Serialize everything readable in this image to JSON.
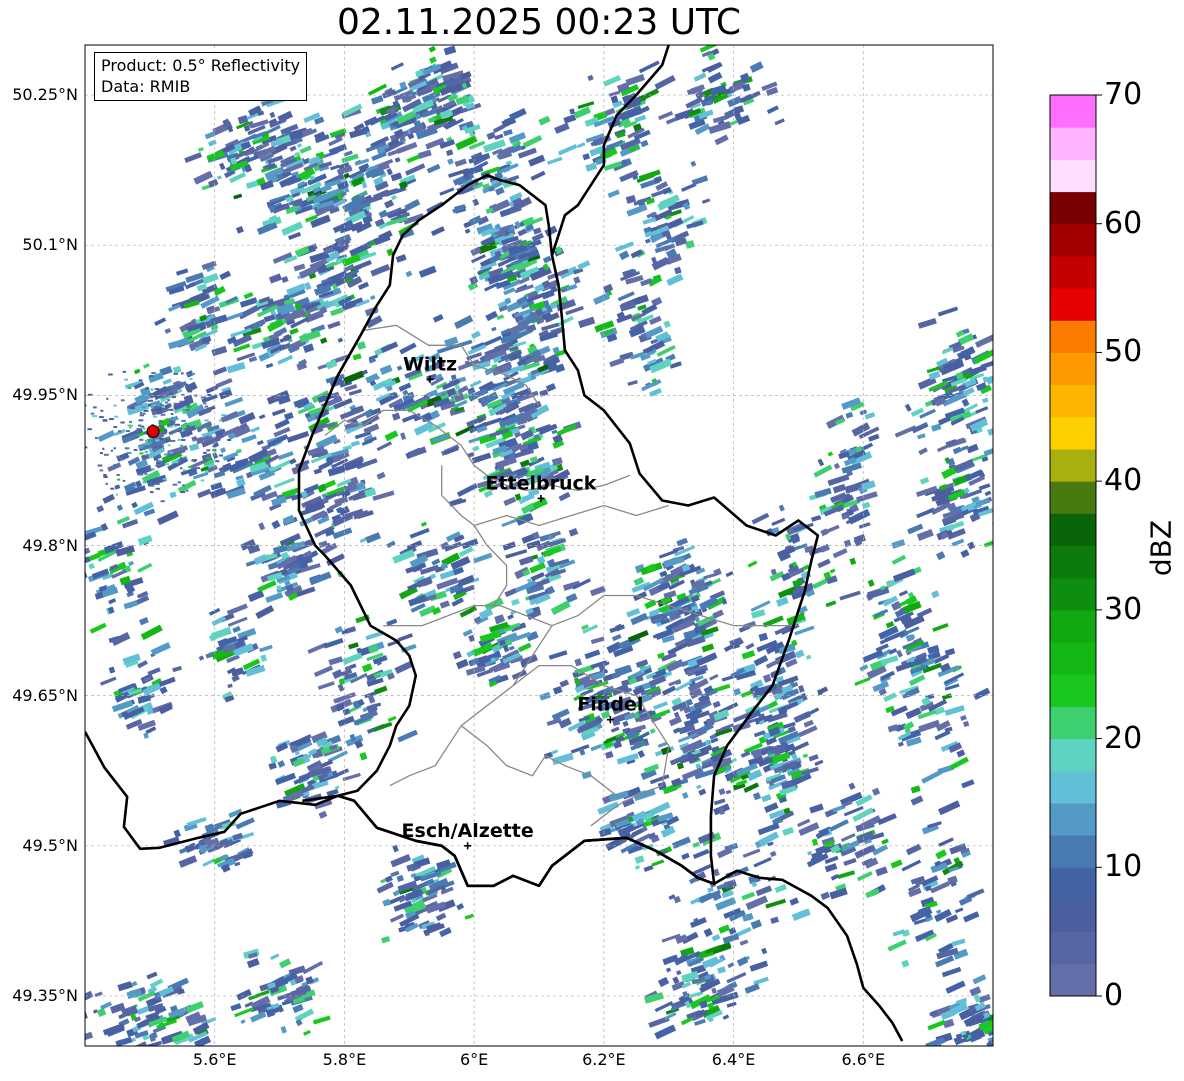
{
  "title": "02.11.2025 00:23 UTC",
  "info": {
    "product": "Product: 0.5° Reflectivity",
    "data": "Data: RMIB"
  },
  "map": {
    "lat_range": [
      49.3,
      50.3
    ],
    "lon_range": [
      5.4,
      6.8
    ],
    "lat_ticks": [
      {
        "value": 50.25,
        "label": "50.25°N"
      },
      {
        "value": 50.1,
        "label": "50.1°N"
      },
      {
        "value": 49.95,
        "label": "49.95°N"
      },
      {
        "value": 49.8,
        "label": "49.8°N"
      },
      {
        "value": 49.65,
        "label": "49.65°N"
      },
      {
        "value": 49.5,
        "label": "49.5°N"
      },
      {
        "value": 49.35,
        "label": "49.35°N"
      }
    ],
    "lon_ticks": [
      {
        "value": 5.6,
        "label": "5.6°E"
      },
      {
        "value": 5.8,
        "label": "5.8°E"
      },
      {
        "value": 6.0,
        "label": "6°E"
      },
      {
        "value": 6.2,
        "label": "6.2°E"
      },
      {
        "value": 6.4,
        "label": "6.4°E"
      },
      {
        "value": 6.6,
        "label": "6.6°E"
      }
    ],
    "grid": true,
    "radar_site": {
      "lon": 5.505,
      "lat": 49.914,
      "color": "#e00000"
    },
    "cities": [
      {
        "name": "Wiltz",
        "lon": 5.932,
        "lat": 49.966
      },
      {
        "name": "Ettelbruck",
        "lon": 6.103,
        "lat": 49.847
      },
      {
        "name": "Findel",
        "lon": 6.21,
        "lat": 49.626
      },
      {
        "name": "Esch/Alzette",
        "lon": 5.99,
        "lat": 49.5
      }
    ],
    "country_border": [
      [
        5.4,
        49.614
      ],
      [
        5.43,
        49.578
      ],
      [
        5.465,
        49.549
      ],
      [
        5.46,
        49.519
      ],
      [
        5.485,
        49.497
      ],
      [
        5.515,
        49.498
      ],
      [
        5.575,
        49.508
      ],
      [
        5.615,
        49.514
      ],
      [
        5.64,
        49.532
      ],
      [
        5.7,
        49.545
      ],
      [
        5.755,
        49.541
      ],
      [
        5.79,
        49.55
      ],
      [
        5.815,
        49.545
      ],
      [
        5.85,
        49.518
      ],
      [
        5.91,
        49.505
      ],
      [
        5.95,
        49.5
      ],
      [
        5.97,
        49.49
      ],
      [
        5.99,
        49.46
      ],
      [
        6.03,
        49.46
      ],
      [
        6.06,
        49.47
      ],
      [
        6.1,
        49.46
      ],
      [
        6.12,
        49.48
      ],
      [
        6.17,
        49.505
      ],
      [
        6.235,
        49.508
      ],
      [
        6.28,
        49.495
      ],
      [
        6.32,
        49.48
      ],
      [
        6.345,
        49.468
      ],
      [
        6.37,
        49.462
      ],
      [
        6.405,
        49.475
      ],
      [
        6.44,
        49.468
      ],
      [
        6.475,
        49.466
      ],
      [
        6.52,
        49.45
      ],
      [
        6.545,
        49.438
      ],
      [
        6.575,
        49.41
      ],
      [
        6.59,
        49.382
      ],
      [
        6.6,
        49.358
      ],
      [
        6.625,
        49.34
      ],
      [
        6.645,
        49.323
      ],
      [
        6.66,
        49.305
      ]
    ],
    "luxembourg_border": [
      [
        5.735,
        49.545
      ],
      [
        5.79,
        49.55
      ],
      [
        5.815,
        49.545
      ],
      [
        5.85,
        49.518
      ],
      [
        5.91,
        49.505
      ],
      [
        5.95,
        49.5
      ],
      [
        5.97,
        49.49
      ],
      [
        5.99,
        49.46
      ],
      [
        6.03,
        49.46
      ],
      [
        6.06,
        49.47
      ],
      [
        6.1,
        49.46
      ],
      [
        6.12,
        49.48
      ],
      [
        6.17,
        49.505
      ],
      [
        6.235,
        49.508
      ],
      [
        6.28,
        49.495
      ],
      [
        6.32,
        49.48
      ],
      [
        6.345,
        49.468
      ],
      [
        6.37,
        49.462
      ],
      [
        6.365,
        49.49
      ],
      [
        6.365,
        49.53
      ],
      [
        6.37,
        49.57
      ],
      [
        6.39,
        49.6
      ],
      [
        6.43,
        49.635
      ],
      [
        6.46,
        49.66
      ],
      [
        6.485,
        49.705
      ],
      [
        6.51,
        49.755
      ],
      [
        6.52,
        49.785
      ],
      [
        6.53,
        49.81
      ],
      [
        6.5,
        49.825
      ],
      [
        6.465,
        49.81
      ],
      [
        6.42,
        49.82
      ],
      [
        6.37,
        49.848
      ],
      [
        6.33,
        49.84
      ],
      [
        6.29,
        49.845
      ],
      [
        6.255,
        49.872
      ],
      [
        6.24,
        49.902
      ],
      [
        6.2,
        49.935
      ],
      [
        6.17,
        49.95
      ],
      [
        6.16,
        49.975
      ],
      [
        6.14,
        49.995
      ],
      [
        6.135,
        50.03
      ],
      [
        6.13,
        50.06
      ],
      [
        6.12,
        50.09
      ],
      [
        6.115,
        50.12
      ],
      [
        6.11,
        50.14
      ],
      [
        6.09,
        50.15
      ],
      [
        6.07,
        50.16
      ],
      [
        6.04,
        50.165
      ],
      [
        6.02,
        50.17
      ],
      [
        5.99,
        50.16
      ],
      [
        5.97,
        50.15
      ],
      [
        5.95,
        50.14
      ],
      [
        5.915,
        50.125
      ],
      [
        5.89,
        50.11
      ],
      [
        5.875,
        50.09
      ],
      [
        5.87,
        50.06
      ],
      [
        5.85,
        50.04
      ],
      [
        5.825,
        50.01
      ],
      [
        5.79,
        49.97
      ],
      [
        5.77,
        49.94
      ],
      [
        5.75,
        49.91
      ],
      [
        5.73,
        49.875
      ],
      [
        5.73,
        49.835
      ],
      [
        5.755,
        49.8
      ],
      [
        5.77,
        49.79
      ],
      [
        5.81,
        49.76
      ],
      [
        5.84,
        49.72
      ],
      [
        5.88,
        49.705
      ],
      [
        5.9,
        49.69
      ],
      [
        5.91,
        49.67
      ],
      [
        5.9,
        49.64
      ],
      [
        5.88,
        49.62
      ],
      [
        5.87,
        49.6
      ],
      [
        5.85,
        49.575
      ],
      [
        5.82,
        49.555
      ],
      [
        5.79,
        49.55
      ]
    ],
    "germany_border_north": [
      [
        6.12,
        50.09
      ],
      [
        6.13,
        50.11
      ],
      [
        6.14,
        50.13
      ],
      [
        6.16,
        50.14
      ],
      [
        6.18,
        50.16
      ],
      [
        6.2,
        50.18
      ],
      [
        6.2,
        50.2
      ],
      [
        6.22,
        50.23
      ],
      [
        6.25,
        50.25
      ],
      [
        6.27,
        50.265
      ],
      [
        6.29,
        50.28
      ],
      [
        6.3,
        50.3
      ]
    ],
    "cantonal_lines": [
      [
        [
          5.83,
          50.015
        ],
        [
          5.88,
          50.02
        ],
        [
          5.93,
          50.0
        ],
        [
          5.98,
          50.0
        ],
        [
          6.0,
          49.98
        ],
        [
          6.05,
          49.97
        ],
        [
          6.08,
          49.96
        ],
        [
          6.1,
          49.94
        ]
      ],
      [
        [
          5.77,
          49.91
        ],
        [
          5.8,
          49.925
        ],
        [
          5.83,
          49.92
        ],
        [
          5.86,
          49.935
        ],
        [
          5.9,
          49.935
        ],
        [
          5.94,
          49.92
        ],
        [
          5.98,
          49.9
        ],
        [
          6.0,
          49.88
        ],
        [
          6.02,
          49.87
        ],
        [
          6.05,
          49.86
        ],
        [
          6.08,
          49.855
        ],
        [
          6.12,
          49.86
        ],
        [
          6.16,
          49.855
        ],
        [
          6.2,
          49.86
        ],
        [
          6.24,
          49.87
        ]
      ],
      [
        [
          5.95,
          49.88
        ],
        [
          5.95,
          49.85
        ],
        [
          5.98,
          49.83
        ],
        [
          6.0,
          49.82
        ],
        [
          6.02,
          49.8
        ],
        [
          6.05,
          49.78
        ],
        [
          6.05,
          49.76
        ],
        [
          6.03,
          49.74
        ]
      ],
      [
        [
          6.0,
          49.82
        ],
        [
          6.05,
          49.83
        ],
        [
          6.1,
          49.82
        ],
        [
          6.15,
          49.83
        ],
        [
          6.2,
          49.84
        ],
        [
          6.25,
          49.83
        ],
        [
          6.3,
          49.84
        ]
      ],
      [
        [
          5.86,
          49.72
        ],
        [
          5.92,
          49.72
        ],
        [
          5.96,
          49.73
        ],
        [
          6.0,
          49.74
        ],
        [
          6.04,
          49.74
        ],
        [
          6.08,
          49.73
        ],
        [
          6.12,
          49.72
        ],
        [
          6.16,
          49.73
        ],
        [
          6.2,
          49.75
        ],
        [
          6.25,
          49.75
        ],
        [
          6.3,
          49.74
        ],
        [
          6.35,
          49.73
        ],
        [
          6.4,
          49.72
        ],
        [
          6.45,
          49.72
        ],
        [
          6.5,
          49.72
        ]
      ],
      [
        [
          6.12,
          49.72
        ],
        [
          6.1,
          49.7
        ],
        [
          6.08,
          49.68
        ],
        [
          6.06,
          49.66
        ],
        [
          6.04,
          49.65
        ],
        [
          6.0,
          49.63
        ],
        [
          5.98,
          49.62
        ],
        [
          5.96,
          49.6
        ],
        [
          5.94,
          49.58
        ],
        [
          5.9,
          49.57
        ],
        [
          5.87,
          49.56
        ]
      ],
      [
        [
          6.06,
          49.66
        ],
        [
          6.1,
          49.68
        ],
        [
          6.15,
          49.68
        ],
        [
          6.2,
          49.66
        ],
        [
          6.25,
          49.65
        ],
        [
          6.28,
          49.62
        ],
        [
          6.3,
          49.6
        ],
        [
          6.29,
          49.56
        ],
        [
          6.25,
          49.55
        ],
        [
          6.22,
          49.54
        ],
        [
          6.2,
          49.53
        ],
        [
          6.18,
          49.52
        ]
      ],
      [
        [
          5.98,
          49.62
        ],
        [
          6.02,
          49.6
        ],
        [
          6.05,
          49.58
        ],
        [
          6.09,
          49.57
        ],
        [
          6.11,
          49.59
        ],
        [
          6.14,
          49.58
        ],
        [
          6.18,
          49.57
        ],
        [
          6.22,
          49.55
        ]
      ]
    ],
    "rain_cells": [
      [
        5.67,
        50.2,
        0.06,
        0.035,
        0.7
      ],
      [
        5.75,
        50.16,
        0.07,
        0.04,
        0.7
      ],
      [
        5.85,
        50.14,
        0.06,
        0.04,
        0.6
      ],
      [
        5.88,
        50.22,
        0.05,
        0.03,
        0.5
      ],
      [
        5.95,
        50.25,
        0.04,
        0.03,
        0.5
      ],
      [
        6.02,
        50.18,
        0.05,
        0.04,
        0.5
      ],
      [
        6.05,
        50.1,
        0.04,
        0.03,
        0.5
      ],
      [
        6.1,
        50.05,
        0.05,
        0.04,
        0.6
      ],
      [
        5.78,
        50.06,
        0.05,
        0.03,
        0.6
      ],
      [
        5.7,
        50.02,
        0.04,
        0.03,
        0.5
      ],
      [
        5.58,
        50.03,
        0.04,
        0.03,
        0.4
      ],
      [
        5.65,
        49.9,
        0.06,
        0.04,
        0.6
      ],
      [
        5.52,
        49.92,
        0.05,
        0.05,
        0.7
      ],
      [
        5.8,
        49.93,
        0.06,
        0.05,
        0.6
      ],
      [
        5.95,
        49.95,
        0.06,
        0.04,
        0.7
      ],
      [
        6.07,
        49.96,
        0.05,
        0.05,
        0.7
      ],
      [
        6.08,
        49.88,
        0.05,
        0.03,
        0.5
      ],
      [
        5.78,
        49.85,
        0.05,
        0.04,
        0.5
      ],
      [
        5.72,
        49.78,
        0.04,
        0.03,
        0.4
      ],
      [
        5.95,
        49.78,
        0.05,
        0.04,
        0.4
      ],
      [
        6.1,
        49.78,
        0.04,
        0.04,
        0.4
      ],
      [
        6.3,
        49.68,
        0.08,
        0.06,
        0.8
      ],
      [
        6.2,
        49.64,
        0.06,
        0.04,
        0.7
      ],
      [
        6.35,
        49.6,
        0.05,
        0.04,
        0.6
      ],
      [
        6.45,
        49.65,
        0.05,
        0.06,
        0.6
      ],
      [
        6.47,
        49.58,
        0.04,
        0.04,
        0.5
      ],
      [
        6.32,
        49.75,
        0.05,
        0.03,
        0.5
      ],
      [
        6.25,
        49.52,
        0.04,
        0.03,
        0.4
      ],
      [
        6.4,
        49.44,
        0.07,
        0.05,
        0.5
      ],
      [
        6.35,
        49.36,
        0.05,
        0.03,
        0.5
      ],
      [
        6.58,
        49.5,
        0.05,
        0.04,
        0.4
      ],
      [
        6.75,
        49.95,
        0.05,
        0.05,
        0.6
      ],
      [
        6.75,
        49.85,
        0.04,
        0.04,
        0.5
      ],
      [
        6.7,
        49.65,
        0.05,
        0.06,
        0.5
      ],
      [
        6.65,
        49.72,
        0.05,
        0.04,
        0.4
      ],
      [
        6.72,
        49.45,
        0.04,
        0.05,
        0.4
      ],
      [
        6.77,
        49.32,
        0.04,
        0.03,
        0.5
      ],
      [
        5.5,
        49.33,
        0.06,
        0.03,
        0.6
      ],
      [
        5.7,
        49.35,
        0.05,
        0.03,
        0.4
      ],
      [
        5.82,
        49.65,
        0.05,
        0.05,
        0.5
      ],
      [
        5.75,
        49.58,
        0.04,
        0.03,
        0.4
      ],
      [
        5.92,
        49.45,
        0.04,
        0.03,
        0.5
      ],
      [
        5.6,
        49.5,
        0.05,
        0.02,
        0.3
      ],
      [
        6.22,
        50.22,
        0.05,
        0.04,
        0.5
      ],
      [
        6.3,
        50.12,
        0.04,
        0.04,
        0.4
      ],
      [
        6.38,
        50.25,
        0.05,
        0.03,
        0.4
      ],
      [
        6.25,
        50.02,
        0.04,
        0.04,
        0.4
      ],
      [
        6.5,
        49.78,
        0.04,
        0.04,
        0.4
      ],
      [
        5.45,
        49.78,
        0.04,
        0.05,
        0.4
      ],
      [
        5.48,
        49.65,
        0.03,
        0.03,
        0.3
      ],
      [
        6.03,
        49.7,
        0.04,
        0.03,
        0.4
      ],
      [
        5.62,
        49.7,
        0.04,
        0.03,
        0.3
      ],
      [
        6.58,
        49.86,
        0.03,
        0.05,
        0.4
      ]
    ]
  },
  "colorbar": {
    "label": "dBZ",
    "min": 0,
    "max": 70,
    "step": 2.5,
    "ticks": [
      "0",
      "10",
      "20",
      "30",
      "40",
      "50",
      "60",
      "70"
    ],
    "colors": [
      "#646ea8",
      "#5666a4",
      "#4a5ea0",
      "#4462a6",
      "#4a7ab2",
      "#549ac6",
      "#62bfd8",
      "#5ed4c0",
      "#3ecf6e",
      "#18c81e",
      "#14b814",
      "#12a812",
      "#0e8e0e",
      "#0c7a0c",
      "#0a640a",
      "#487a10",
      "#a8b010",
      "#ffd000",
      "#fdb500",
      "#fc9a00",
      "#fc7c00",
      "#e60000",
      "#c40000",
      "#a20000",
      "#780000",
      "#ffddff",
      "#ffb5ff",
      "#ff6eff",
      "#e83cf2"
    ]
  }
}
